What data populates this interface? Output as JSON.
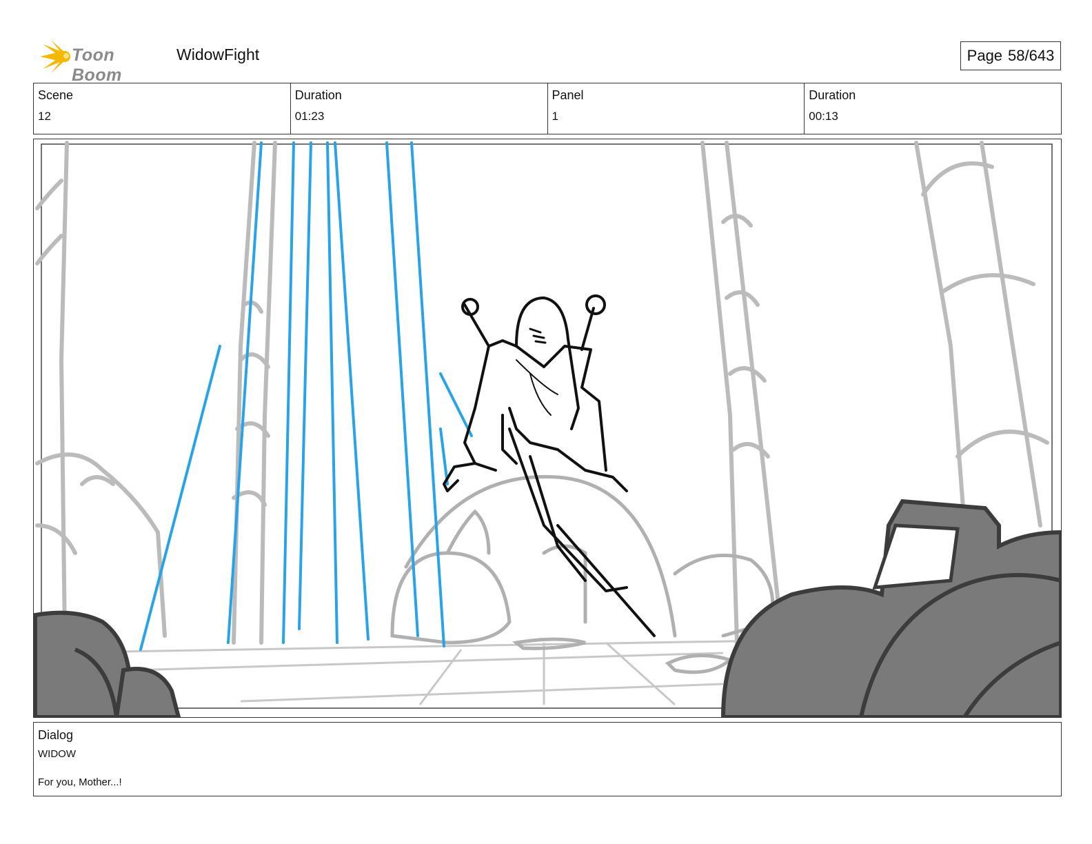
{
  "header": {
    "logo_text": "Toon Boom",
    "project_title": "WidowFight",
    "page_label": "Page",
    "page_value": "58/643"
  },
  "info": {
    "scene_label": "Scene",
    "scene_value": "12",
    "scene_duration_label": "Duration",
    "scene_duration_value": "01:23",
    "panel_label": "Panel",
    "panel_value": "1",
    "panel_duration_label": "Duration",
    "panel_duration_value": "00:13"
  },
  "dialog": {
    "label": "Dialog",
    "speaker": "WIDOW",
    "line": "For you, Mother...!"
  },
  "colors": {
    "logo_burst": "#f5b800",
    "beam": "#29a3e8",
    "sketch_gray": "#b5b5b5",
    "dark_fill": "#7a7a7a"
  }
}
